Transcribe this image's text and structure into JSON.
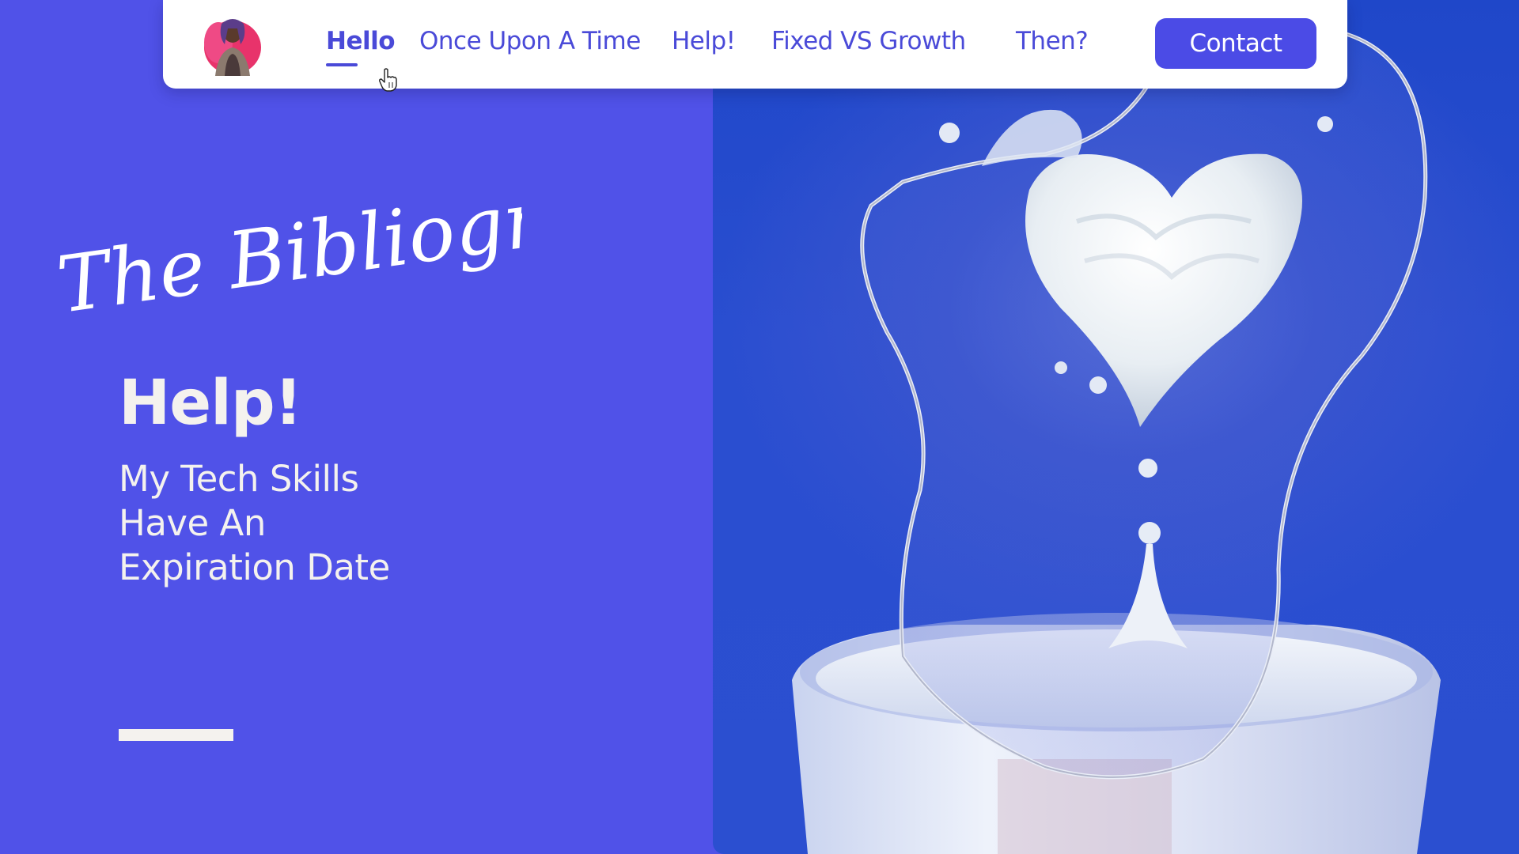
{
  "nav": {
    "items": [
      {
        "label": "Hello",
        "active": true
      },
      {
        "label": "Once Upon A Time",
        "active": false
      },
      {
        "label": "Help!",
        "active": false
      },
      {
        "label": "Fixed VS Growth",
        "active": false
      },
      {
        "label": "Then?",
        "active": false
      }
    ],
    "contact_label": "Contact"
  },
  "hero": {
    "script_title": "The Bibliography",
    "heading": "Help!",
    "subtitle": "My Tech Skills Have An Expiration Date"
  },
  "colors": {
    "background": "#5052e8",
    "nav_text": "#4a4ad8",
    "button": "#4b4be6",
    "light_text": "#f4f2ee"
  },
  "icons": {
    "avatar": "profile-avatar",
    "cursor": "hand-pointer-icon"
  }
}
